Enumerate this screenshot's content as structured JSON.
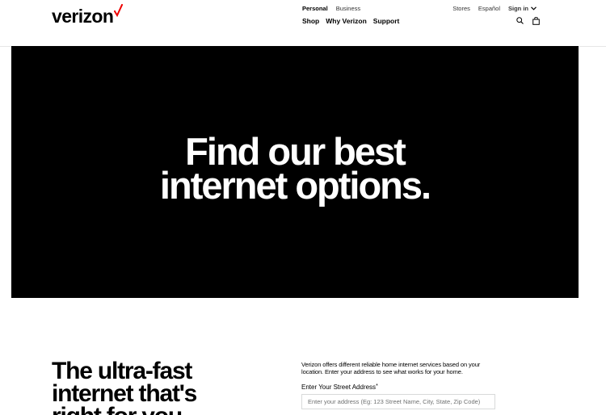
{
  "brand": {
    "logo_text": "verizon",
    "accent_color": "#ee0000"
  },
  "header": {
    "segments": {
      "personal": "Personal",
      "business": "Business"
    },
    "nav": {
      "shop": "Shop",
      "why_verizon": "Why Verizon",
      "support": "Support"
    },
    "utility": {
      "stores": "Stores",
      "espanol": "Español",
      "sign_in": "Sign in"
    },
    "icons": [
      "search-icon",
      "cart-icon",
      "chevron-down-icon"
    ]
  },
  "hero": {
    "line1": "Find our best",
    "line2": "internet options.",
    "background": "#000000"
  },
  "section": {
    "heading_line1": "The ultra-fast",
    "heading_line2": "internet that's",
    "heading_line3": "right for you.",
    "description": "Verizon offers different reliable home internet services based on your location. Enter your address to see what works for your home.",
    "address_label": "Enter Your Street Address",
    "required_mark": "*",
    "address_placeholder": "Enter your address (Eg: 123 Street Name, City, State, Zip Code)",
    "address_value": ""
  }
}
